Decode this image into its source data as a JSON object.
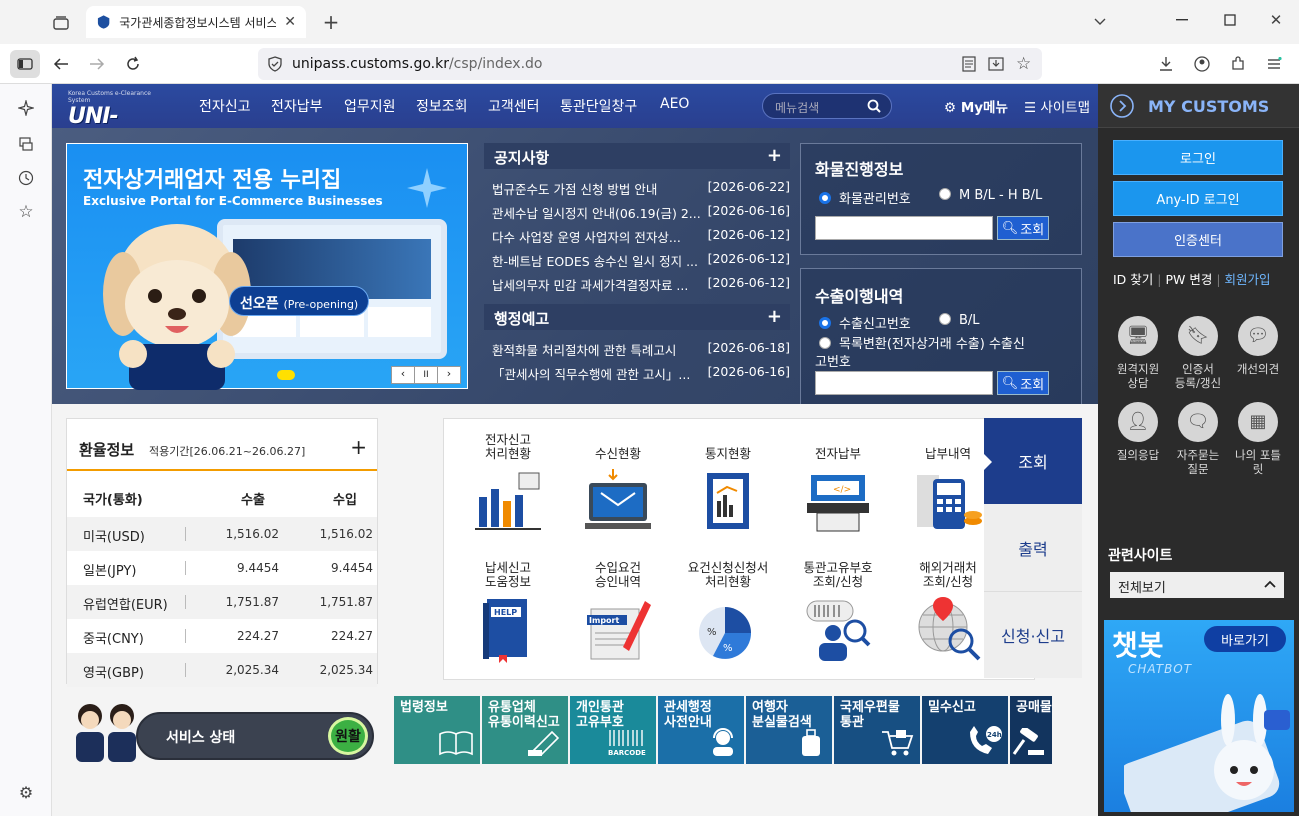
{
  "browser": {
    "tab_title": "국가관세종합정보시스템 서비스",
    "url_domain": "unipass.customs.go.kr",
    "url_path": "/csp/index.do"
  },
  "site": {
    "logo_small": "Korea Customs e-Clearance System",
    "logo_text": "UNI-PASS",
    "gnb": [
      "전자신고",
      "전자납부",
      "업무지원",
      "정보조회",
      "고객센터",
      "통관단일창구",
      "AEO"
    ],
    "menu_search_placeholder": "메뉴검색",
    "my_menu": "My메뉴",
    "sitemap": "사이트맵",
    "banner": {
      "title": "전자상거래업자 전용 누리집",
      "subtitle": "Exclusive Portal for E-Commerce Businesses",
      "badge": "선오픈",
      "badge_en": "(Pre-opening)",
      "pause_glyph": "II"
    },
    "notice": {
      "title": "공지사항",
      "items": [
        {
          "text": "법규준수도 가점 신청 방법 안내",
          "date": "[2026-06-22]"
        },
        {
          "text": "관세수납 일시정지 안내(06.19(금) 2...",
          "date": "[2026-06-16]"
        },
        {
          "text": "다수 사업장 운영 사업자의 전자상...",
          "date": "[2026-06-12]"
        },
        {
          "text": "한-베트남 EODES 송수신 일시 정지 ...",
          "date": "[2026-06-12]"
        },
        {
          "text": "납세의무자 민감 과세가격결정자료 ...",
          "date": "[2026-06-12]"
        }
      ]
    },
    "admin_notice": {
      "title": "행정예고",
      "items": [
        {
          "text": "환적화물 처리절차에 관한 특례고시",
          "date": "[2026-06-18]"
        },
        {
          "text": "「관세사의 직무수행에 관한 고시」...",
          "date": "[2026-06-16]"
        }
      ]
    },
    "cargo": {
      "title": "화물진행정보",
      "opt1": "화물관리번호",
      "opt2": "M B/L - H B/L",
      "btn": "조회"
    },
    "export": {
      "title": "수출이행내역",
      "opt1": "수출신고번호",
      "opt2": "B/L",
      "opt3": "목록변환(전자상거래 수출) 수출신",
      "opt3b": "고번호",
      "btn": "조회"
    },
    "rate": {
      "title": "환율정보",
      "period": "적용기간[26.06.21~26.06.27]",
      "headers": [
        "국가(통화)",
        "수출",
        "수입"
      ],
      "rows": [
        [
          "미국(USD)",
          "1,516.02",
          "1,516.02"
        ],
        [
          "일본(JPY)",
          "9.4454",
          "9.4454"
        ],
        [
          "유럽연합(EUR)",
          "1,751.87",
          "1,751.87"
        ],
        [
          "중국(CNY)",
          "224.27",
          "224.27"
        ],
        [
          "영국(GBP)",
          "2,025.34",
          "2,025.34"
        ]
      ]
    },
    "services": [
      {
        "l1": "전자신고",
        "l2": "처리현황"
      },
      {
        "l1": "수신현황",
        "l2": ""
      },
      {
        "l1": "통지현황",
        "l2": ""
      },
      {
        "l1": "전자납부",
        "l2": ""
      },
      {
        "l1": "납부내역",
        "l2": ""
      },
      {
        "l1": "납세신고",
        "l2": "도움정보"
      },
      {
        "l1": "수입요건",
        "l2": "승인내역"
      },
      {
        "l1": "요건신청신청서",
        "l2": "처리현황"
      },
      {
        "l1": "통관고유부호",
        "l2": "조회/신청"
      },
      {
        "l1": "해외거래처",
        "l2": "조회/신청"
      }
    ],
    "vtabs": [
      "조회",
      "출력",
      "신청·신고"
    ],
    "status": {
      "label": "서비스 상태",
      "value": "원활"
    },
    "quick": [
      {
        "l1": "법령정보",
        "l2": ""
      },
      {
        "l1": "유통업체",
        "l2": "유통이력신고"
      },
      {
        "l1": "개인통관",
        "l2": "고유부호"
      },
      {
        "l1": "관세행정",
        "l2": "사전안내"
      },
      {
        "l1": "여행자",
        "l2": "분실물검색"
      },
      {
        "l1": "국제우편물",
        "l2": "통관"
      },
      {
        "l1": "밀수신고",
        "l2": ""
      },
      {
        "l1": "공매물품조회",
        "l2": ""
      }
    ],
    "icons": {
      "help": "HELP",
      "import": "Import",
      "barcode": "BARCODE",
      "hours": "24h"
    }
  },
  "mycustoms": {
    "title": "MY CUSTOMS",
    "login": "로그인",
    "anyid": "Any-ID 로그인",
    "cert": "인증센터",
    "find_id": "ID 찾기",
    "pw_change": "PW 변경",
    "join": "회원가입",
    "icons": [
      {
        "l1": "원격지원",
        "l2": "상담"
      },
      {
        "l1": "인증서",
        "l2": "등록/갱신"
      },
      {
        "l1": "개선의견",
        "l2": ""
      },
      {
        "l1": "질의응답",
        "l2": ""
      },
      {
        "l1": "자주묻는",
        "l2": "질문"
      },
      {
        "l1": "나의 포틀",
        "l2": "릿"
      }
    ],
    "related_title": "관련사이트",
    "related_select": "전체보기",
    "chatbot": "챗봇",
    "chatbot_en": "CHATBOT",
    "chatbot_btn": "바로가기"
  },
  "colors": {
    "accent": "#1b96ee",
    "gnb": "#2a3f8f",
    "quick_teal": "#1f8a8a"
  }
}
